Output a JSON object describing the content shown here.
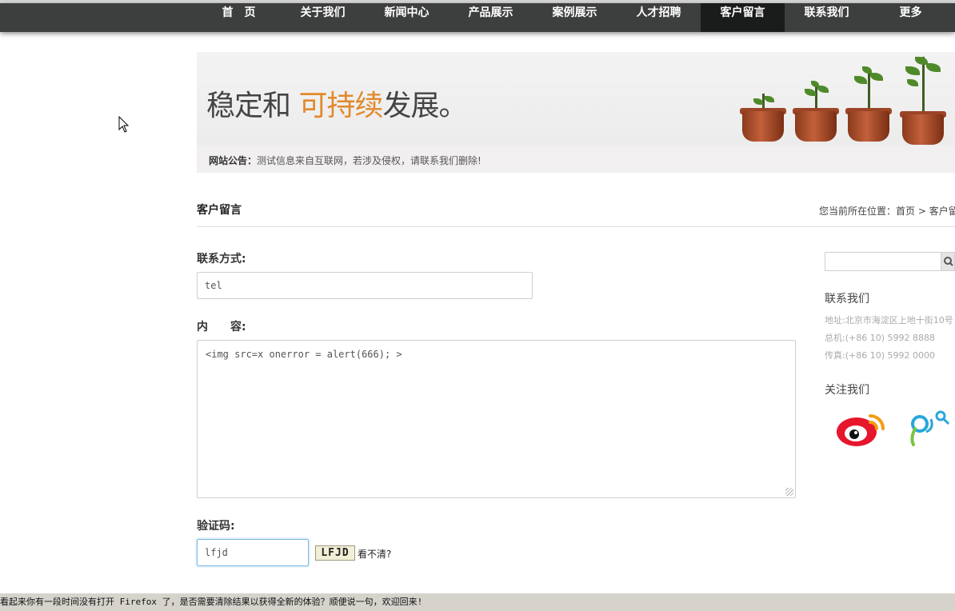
{
  "nav": {
    "items": [
      "首　页",
      "关于我们",
      "新闻中心",
      "产品展示",
      "案例展示",
      "人才招聘",
      "客户留言",
      "联系我们",
      "更多"
    ],
    "active_index": 6,
    "colors": {
      "bar": "#3d3f3e",
      "active": "#1a1c1b"
    }
  },
  "banner": {
    "slogan_part1": "稳定和 ",
    "slogan_highlight": "可持续",
    "slogan_part2": "发展。",
    "highlight_color": "#e2892c"
  },
  "notice": {
    "label": "网站公告：",
    "text": "测试信息来自互联网，若涉及侵权，请联系我们删除!"
  },
  "page": {
    "title": "客户留言",
    "breadcrumb_prefix": "您当前所在位置：",
    "breadcrumb_home": "首页",
    "breadcrumb_sep": " > ",
    "breadcrumb_current": "客户留言"
  },
  "form": {
    "contact_label": "联系方式:",
    "contact_value": "tel",
    "content_label": "内　　容:",
    "content_value": "<img src=x onerror = alert(666); >",
    "captcha_label": "验证码:",
    "captcha_value": "lfjd",
    "captcha_image_text": "LFJD",
    "captcha_refresh": "看不清?"
  },
  "sidebar": {
    "search_icon": "search-icon",
    "contact_heading": "联系我们",
    "address": "地址:北京市海淀区上地十街10号",
    "phone": "总机:(+86 10) 5992 8888",
    "fax": "传真:(+86 10) 5992 0000",
    "follow_heading": "关注我们",
    "social_icons": [
      "weibo-icon",
      "tencent-weibo-icon"
    ]
  },
  "statusbar": {
    "text": "看起来你有一段时间没有打开 Firefox 了，是否需要清除结果以获得全新的体验？顺便说一句，欢迎回来!"
  }
}
